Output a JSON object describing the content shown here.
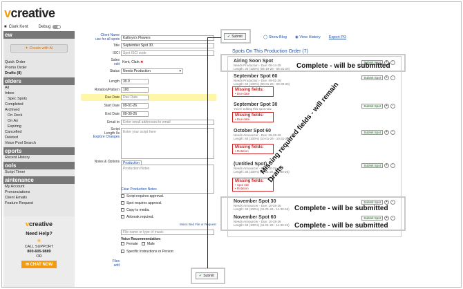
{
  "header": {
    "logo_v": "v",
    "logo_rest": "creative",
    "user": "Clark Kent",
    "debug_label": "Debug"
  },
  "sidebar": {
    "section_new": "ew",
    "create_ai": "Create with AI",
    "items_top": [
      "Quick Order",
      "Promo Order",
      "Drafts  (8)"
    ],
    "section_folders": "olders",
    "folder_items": [
      "All",
      "Inbox",
      "Spec Spots",
      "Completed",
      "Archived",
      "On Deck",
      "On Air",
      "Expiring",
      "Cancelled",
      "Deleted",
      "Voice Pool Search"
    ],
    "section_reports": "eports",
    "report_items": [
      "Recent History"
    ],
    "section_tools": "ools",
    "tool_items": [
      "Script Timer"
    ],
    "section_maint": "aintenance",
    "maint_items": [
      "My Account",
      "Pronunciations",
      "Client Emails",
      "Feature Request"
    ],
    "help": {
      "title": "Need Help?",
      "call": "CALL SUPPORT",
      "phone": "800-605-9889",
      "or": "OR",
      "chat": "CHAT NOW"
    }
  },
  "form": {
    "client_name_label": "Client Name",
    "client_name_sub": "use for all spots",
    "client_name": "Kathryn's Flowers",
    "title_label": "Title",
    "title": "September Spot 30",
    "isci_label": "ISCI",
    "isci_ph": "Spot ISCI code",
    "sales_label": "Sales",
    "sales_sub": "edit",
    "sales": "Kent, Clark",
    "status_label": "Status",
    "status": "Needs Production",
    "length_label": "Length",
    "length": "30.0",
    "rotation_label": "Rotation/Pattern",
    "rotation": "100",
    "due_label": "Due Date",
    "due_ph": "Due Date",
    "start_label": "Start Date",
    "start": "09-01-26",
    "end_label": "End Date",
    "end": "09-30-26",
    "email_label": "Email to",
    "email_ph": "Enter email addresses to email",
    "script_label": "Script",
    "script_sub": "Length 0s",
    "explore_changes": "Explore Changes",
    "script_ph": "Enter your script here",
    "notes_label": "Notes & Options",
    "tab_production": "Production",
    "notes_ph": "Production Notes",
    "clear_notes": "Clear Production Notes",
    "checks": [
      "Script requires approval.",
      "Spot requires approval.",
      "Copy to media.",
      "Airbreak required."
    ],
    "music_link": "Music Bed File or Request",
    "music_ph": "File name or type of music",
    "voice_rec": "Voice Recommendation:",
    "female": "Female",
    "male": "Male",
    "specific": "Specific Instructions or Person:",
    "files_label": "Files",
    "files_sub": "add",
    "submit": "Submit"
  },
  "panel": {
    "links": [
      "Show Blog",
      "View History",
      "Export PO"
    ],
    "title": "Spots On This Production Order (7)",
    "submit_spot": "Submit Spot",
    "spots": [
      {
        "title": "Airing Soon Spot",
        "meta1": "Needs Production - Due: 06-14-26",
        "meta2": "Length: 30 (100%) (06-19-26 - 06-31-26)"
      },
      {
        "title": "September Spot 60",
        "meta1": "Needs Production - Due: 09-01-26",
        "meta2": "Length: 60 (100%) (09-01-26 - 09-30-26)"
      },
      {
        "title": "September Spot 30",
        "meta1": "You're editing this spot now."
      },
      {
        "title": "October Spot 60",
        "meta1": "Needs Announcer - Due: 09-28-26",
        "meta2": "Length: 60 (100%) (10-01-26 - 10-31-26)"
      },
      {
        "title": "(Untitled Spot)",
        "meta1": "Needs Announcer - Due: 10-28-26",
        "meta2": "Length: 30 (100%) (11-01-26 - 11-30-26)"
      },
      {
        "title": "November Spot 30",
        "meta1": "Needs Announcer - Due: 10-28-26",
        "meta2": "Length: 30 (100%) (11-01-26 - 11-30-26)"
      },
      {
        "title": "November Spot 60",
        "meta1": "Needs Announcer - Due: 10-28-26",
        "meta2": "Length: 60 (100%) (11-01-26 - 11-30-26)"
      }
    ],
    "missing_header": "Missing fields:",
    "missing_due": "Due date",
    "missing_rotation": "Rotation",
    "missing_title": "Spot title"
  },
  "annotations": {
    "complete": "Complete - will be submitted",
    "missing1": "Missing required fields - will remain",
    "missing2": "Drafts"
  }
}
